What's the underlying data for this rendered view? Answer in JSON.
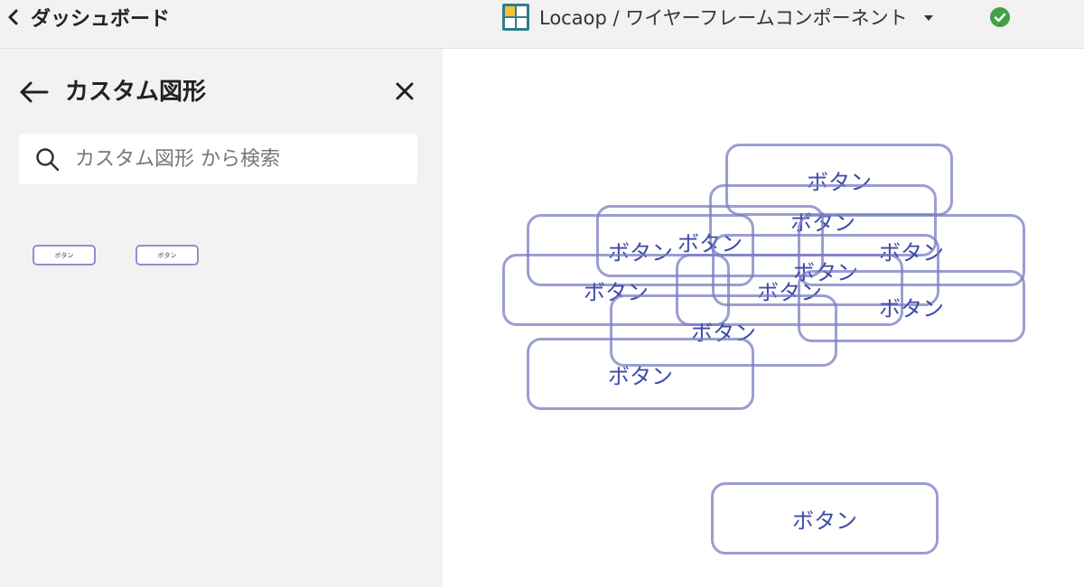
{
  "topbar": {
    "back_label": "ダッシュボード",
    "project_name": "Locaop / ワイヤーフレームコンポーネント",
    "status": "saved",
    "status_color": "#43a047"
  },
  "sidebar": {
    "title": "カスタム図形",
    "search": {
      "placeholder": "カスタム図形 から検索",
      "value": ""
    },
    "shapes": [
      {
        "label": "ボタン"
      },
      {
        "label": "ボタン"
      }
    ]
  },
  "canvas": {
    "buttons": [
      {
        "label": "ボタン"
      },
      {
        "label": "ボタン"
      },
      {
        "label": "ボタン"
      },
      {
        "label": "ボタン"
      },
      {
        "label": "ボタン"
      },
      {
        "label": "ボタン"
      },
      {
        "label": "ボタン"
      },
      {
        "label": "ボタン"
      },
      {
        "label": "ボタン"
      },
      {
        "label": "ボタン"
      },
      {
        "label": "ボタン"
      },
      {
        "label": "ボタン"
      }
    ]
  },
  "colors": {
    "shape_border": "#8e91cc",
    "shape_text": "#3e4aa8",
    "panel_bg": "#f2f2f2"
  }
}
